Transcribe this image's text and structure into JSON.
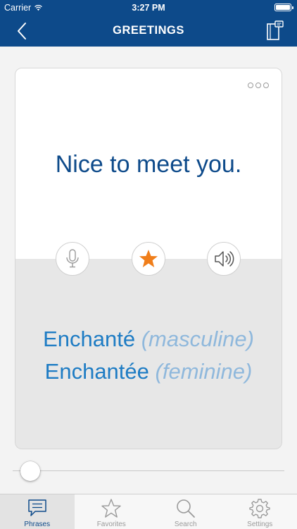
{
  "status_bar": {
    "carrier": "Carrier",
    "time": "3:27 PM",
    "battery_level": 1.0
  },
  "nav": {
    "title": "GREETINGS",
    "back_icon": "chevron-left-icon",
    "phrasebook_icon": "phrasebook-icon"
  },
  "card": {
    "phrase": "Nice to meet you.",
    "actions": [
      {
        "name": "microphone",
        "icon": "microphone-icon"
      },
      {
        "name": "favorite",
        "icon": "star-icon",
        "active": true,
        "color": "#f07e1a"
      },
      {
        "name": "speaker",
        "icon": "speaker-icon"
      }
    ],
    "translations": [
      {
        "word": "Enchanté",
        "note": "(masculine)"
      },
      {
        "word": "Enchantée",
        "note": "(feminine)"
      }
    ]
  },
  "slider": {
    "value": 0.0
  },
  "tabs": [
    {
      "label": "Phrases",
      "icon": "chat-bubble-icon",
      "active": true
    },
    {
      "label": "Favorites",
      "icon": "star-outline-icon",
      "active": false
    },
    {
      "label": "Search",
      "icon": "magnifier-icon",
      "active": false
    },
    {
      "label": "Settings",
      "icon": "gear-icon",
      "active": false
    }
  ],
  "colors": {
    "brand": "#0d4a8a",
    "translation": "#1e7cc4",
    "translation_note": "#8fb8dc",
    "star": "#f07e1a"
  }
}
